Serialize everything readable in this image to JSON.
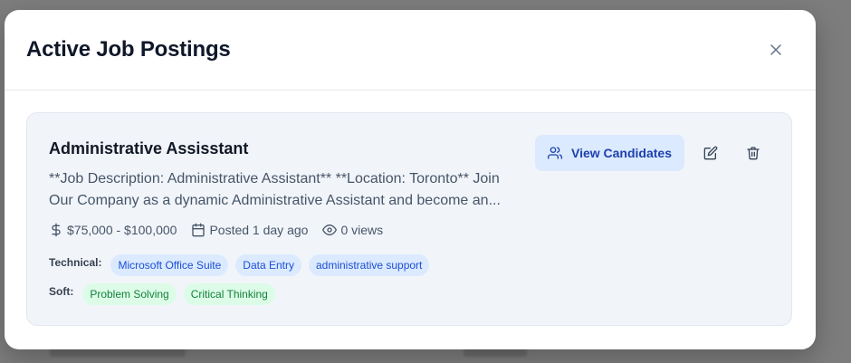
{
  "modal": {
    "title": "Active Job Postings"
  },
  "job": {
    "title": "Administrative Assisstant",
    "description": "**Job Description: Administrative Assistant** **Location: Toronto** Join Our Company as a dynamic Administrative Assistant and become an...",
    "salary": "$75,000 - $100,000",
    "posted": "Posted 1 day ago",
    "views": "0 views",
    "view_candidates_label": "View Candidates",
    "technical_label": "Technical:",
    "technical_skills": [
      "Microsoft Office Suite",
      "Data Entry",
      "administrative support"
    ],
    "soft_label": "Soft:",
    "soft_skills": [
      "Problem Solving",
      "Critical Thinking"
    ]
  },
  "colors": {
    "overlay": "#7d7d7d",
    "card_bg": "#f1f5f9",
    "accent_blue": "#1e40af",
    "tech_tag_bg": "#dbeafe",
    "soft_tag_bg": "#dcfce7"
  },
  "icons": {
    "close": "close-icon",
    "dollar": "dollar-icon",
    "calendar": "calendar-icon",
    "eye": "eye-icon",
    "users": "users-icon",
    "edit": "edit-icon",
    "trash": "trash-icon"
  }
}
